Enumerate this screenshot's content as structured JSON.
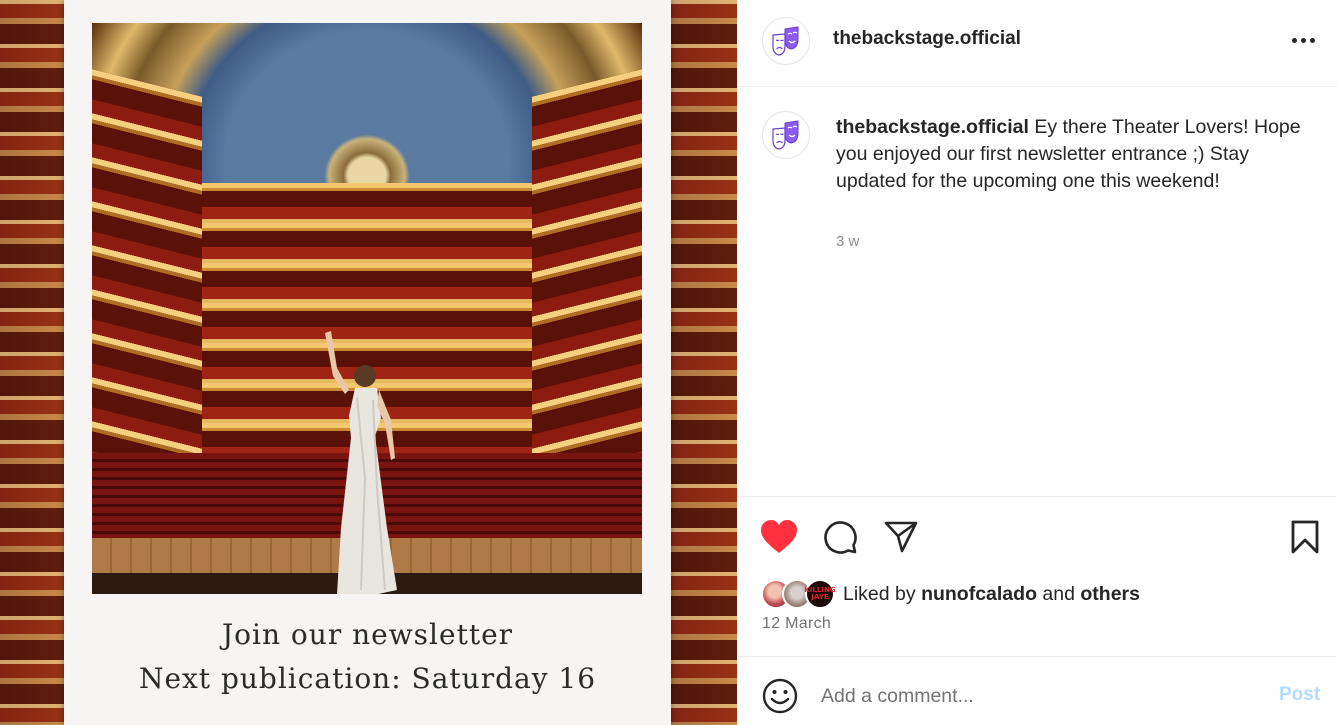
{
  "post": {
    "media": {
      "caption_line_1": "Join our newsletter",
      "caption_line_2": "Next publication: Saturday 16"
    },
    "header": {
      "username": "thebackstage.official",
      "avatar_icon": "theater-masks-icon",
      "more_icon": "more-options-icon"
    },
    "caption": {
      "username": "thebackstage.official",
      "text": "Ey there Theater Lovers! Hope you enjoyed our first newsletter entrance ;) Stay updated for the upcoming one this weekend!",
      "time_ago": "3 w"
    },
    "actions": {
      "like_icon": "heart-filled-icon",
      "comment_icon": "comment-icon",
      "share_icon": "paper-plane-icon",
      "save_icon": "bookmark-icon",
      "like_color": "#ff3040"
    },
    "likes": {
      "prefix": "Liked by",
      "user": "nunofcalado",
      "connector": "and",
      "others": "others",
      "third_avatar_text": "KILLING JAYE"
    },
    "date": "12 March",
    "comment_box": {
      "placeholder": "Add a comment...",
      "post_label": "Post",
      "emoji_icon": "smiley-icon",
      "post_color": "#b3dbff"
    }
  }
}
